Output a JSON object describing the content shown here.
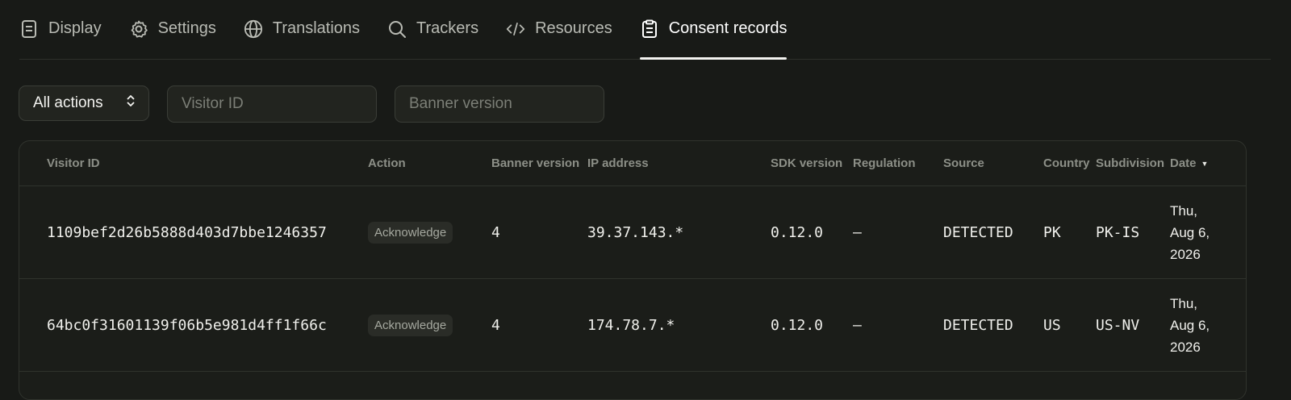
{
  "tabs": [
    {
      "label": "Display",
      "icon": "document-icon",
      "active": false
    },
    {
      "label": "Settings",
      "icon": "gear-icon",
      "active": false
    },
    {
      "label": "Translations",
      "icon": "globe-icon",
      "active": false
    },
    {
      "label": "Trackers",
      "icon": "search-icon",
      "active": false
    },
    {
      "label": "Resources",
      "icon": "code-icon",
      "active": false
    },
    {
      "label": "Consent records",
      "icon": "clipboard-icon",
      "active": true
    }
  ],
  "filters": {
    "action_select": "All actions",
    "visitor_placeholder": "Visitor ID",
    "banner_placeholder": "Banner version"
  },
  "table": {
    "headers": {
      "visitor_id": "Visitor ID",
      "action": "Action",
      "banner_version": "Banner version",
      "ip_address": "IP address",
      "sdk_version": "SDK version",
      "regulation": "Regulation",
      "source": "Source",
      "country": "Country",
      "subdivision": "Subdivision",
      "date": "Date"
    },
    "rows": [
      {
        "visitor_id": "1109bef2d26b5888d403d7bbe1246357",
        "action": "Acknowledge",
        "banner_version": "4",
        "ip_address": "39.37.143.*",
        "sdk_version": "0.12.0",
        "regulation": "–",
        "source": "DETECTED",
        "country": "PK",
        "subdivision": "PK-IS",
        "date_line1": "Thu,",
        "date_line2": "Aug 6,",
        "date_line3": "2026"
      },
      {
        "visitor_id": "64bc0f31601139f06b5e981d4ff1f66c",
        "action": "Acknowledge",
        "banner_version": "4",
        "ip_address": "174.78.7.*",
        "sdk_version": "0.12.0",
        "regulation": "–",
        "source": "DETECTED",
        "country": "US",
        "subdivision": "US-NV",
        "date_line1": "Thu,",
        "date_line2": "Aug 6,",
        "date_line3": "2026"
      }
    ]
  }
}
